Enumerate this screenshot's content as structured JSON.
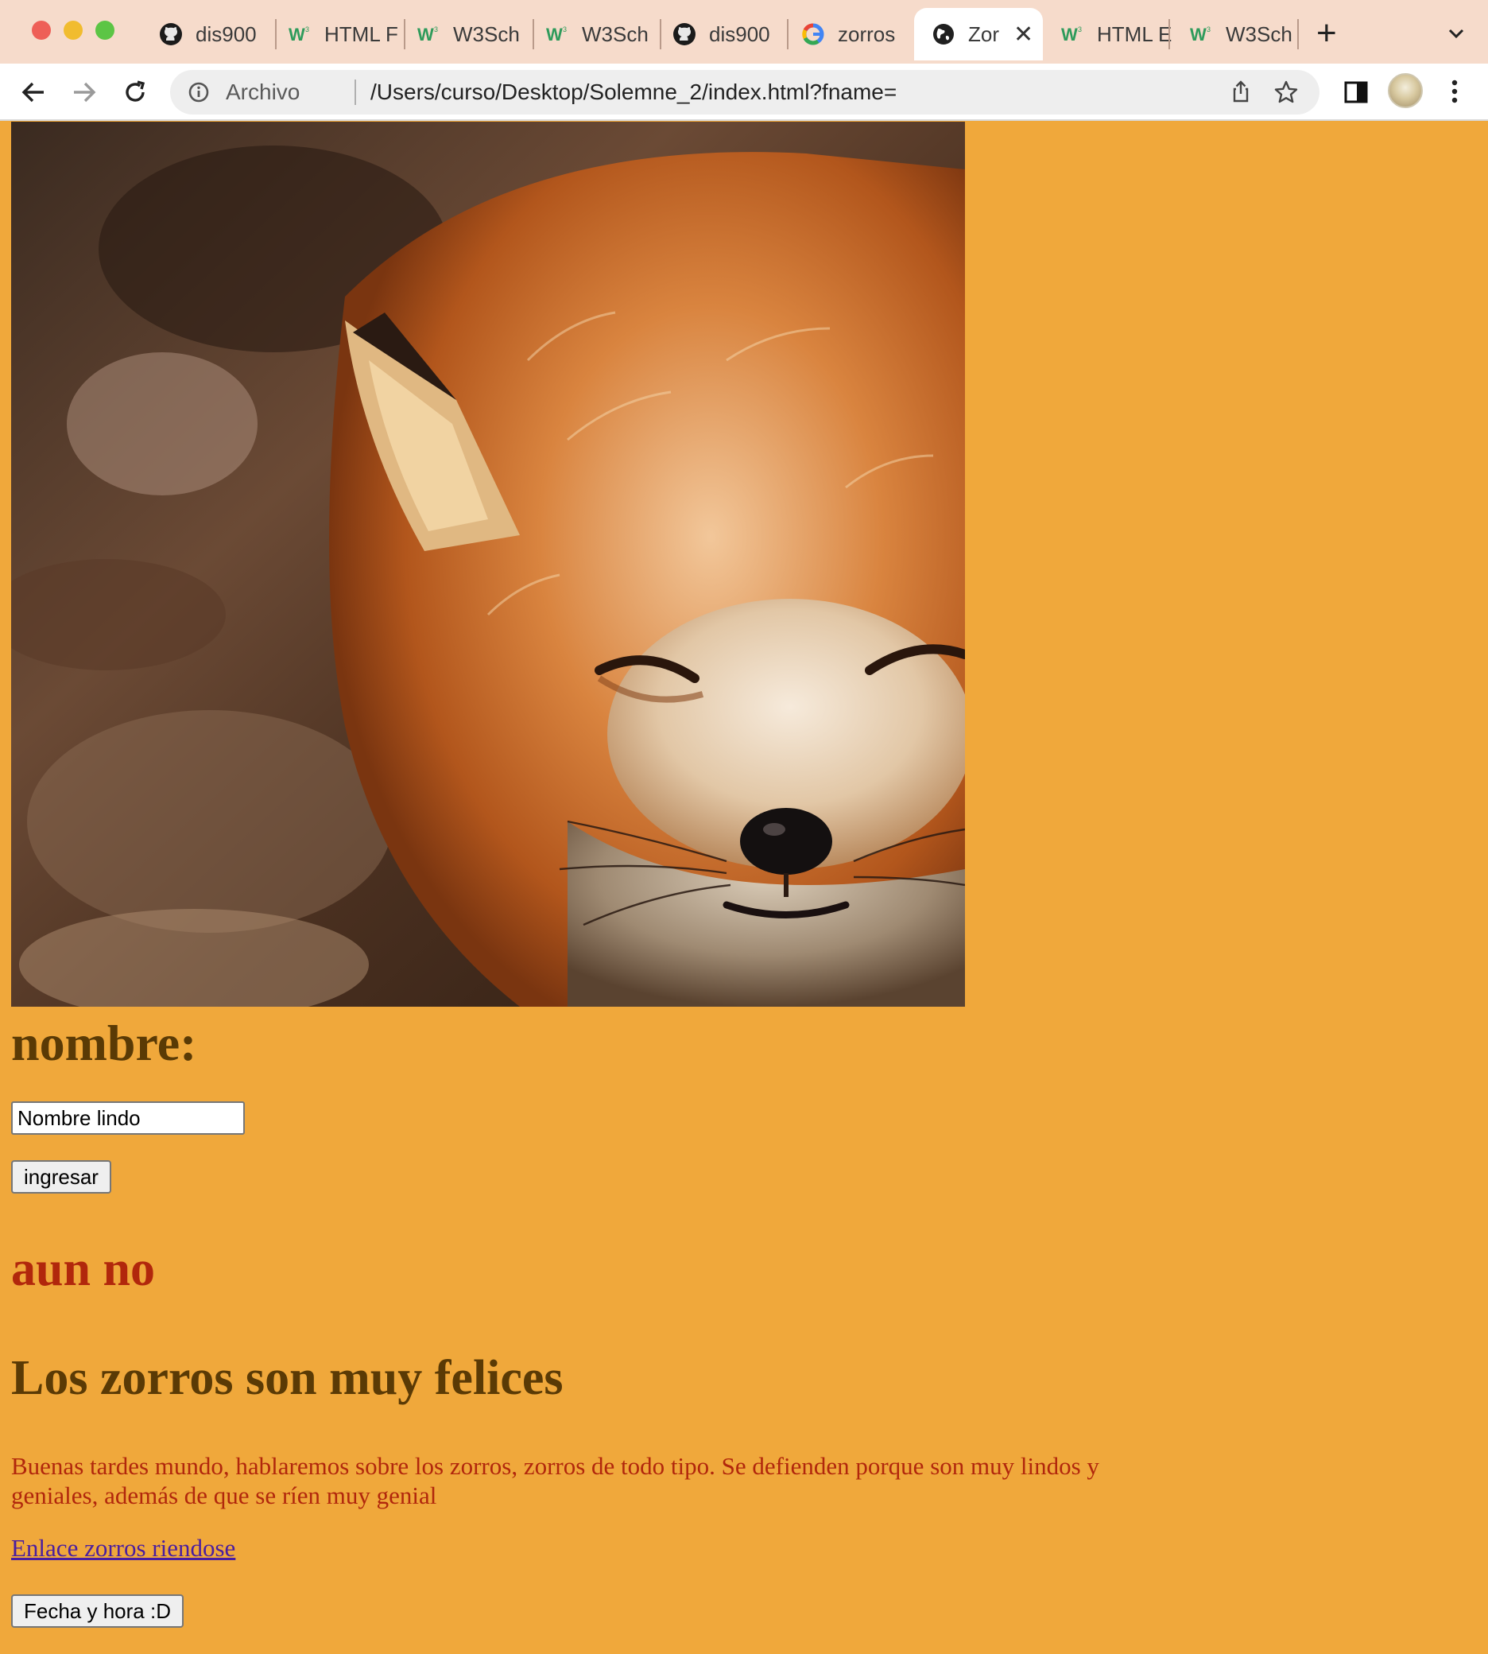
{
  "browser": {
    "tabs": [
      {
        "label": "dis900",
        "icon": "github-icon",
        "active": false
      },
      {
        "label": "HTML F",
        "icon": "w3schools-icon",
        "active": false
      },
      {
        "label": "W3Sch",
        "icon": "w3schools-icon",
        "active": false
      },
      {
        "label": "W3Sch",
        "icon": "w3schools-icon",
        "active": false
      },
      {
        "label": "dis900",
        "icon": "github-icon",
        "active": false
      },
      {
        "label": "zorros",
        "icon": "google-icon",
        "active": false
      },
      {
        "label": "Zor",
        "icon": "globe-icon",
        "active": true
      },
      {
        "label": "HTML E",
        "icon": "w3schools-icon",
        "active": false
      },
      {
        "label": "W3Sch",
        "icon": "w3schools-icon",
        "active": false
      }
    ],
    "address": {
      "scheme_label": "Archivo",
      "url": "/Users/curso/Desktop/Solemne_2/index.html?fname="
    },
    "colors": {
      "tabbar": "#f6dbcb",
      "toolbar": "#ffffff"
    }
  },
  "page": {
    "background": "#f0a83b",
    "image": {
      "icon": "fox-photo"
    },
    "name_heading": "nombre:",
    "name_input_value": "Nombre lindo",
    "submit_label": "ingresar",
    "status_heading": "aun no",
    "title": "Los zorros son muy felices",
    "description": "Buenas tardes mundo, hablaremos sobre los zorros, zorros de todo tipo. Se defienden porque son muy lindos y geniales, además de que se ríen muy genial",
    "link_text": "Enlace zorros riendose",
    "date_button_label": "Fecha y hora :D",
    "colors": {
      "heading_dark": "#5a3a05",
      "accent_red": "#b1270c",
      "link": "#4a1ea0"
    }
  }
}
